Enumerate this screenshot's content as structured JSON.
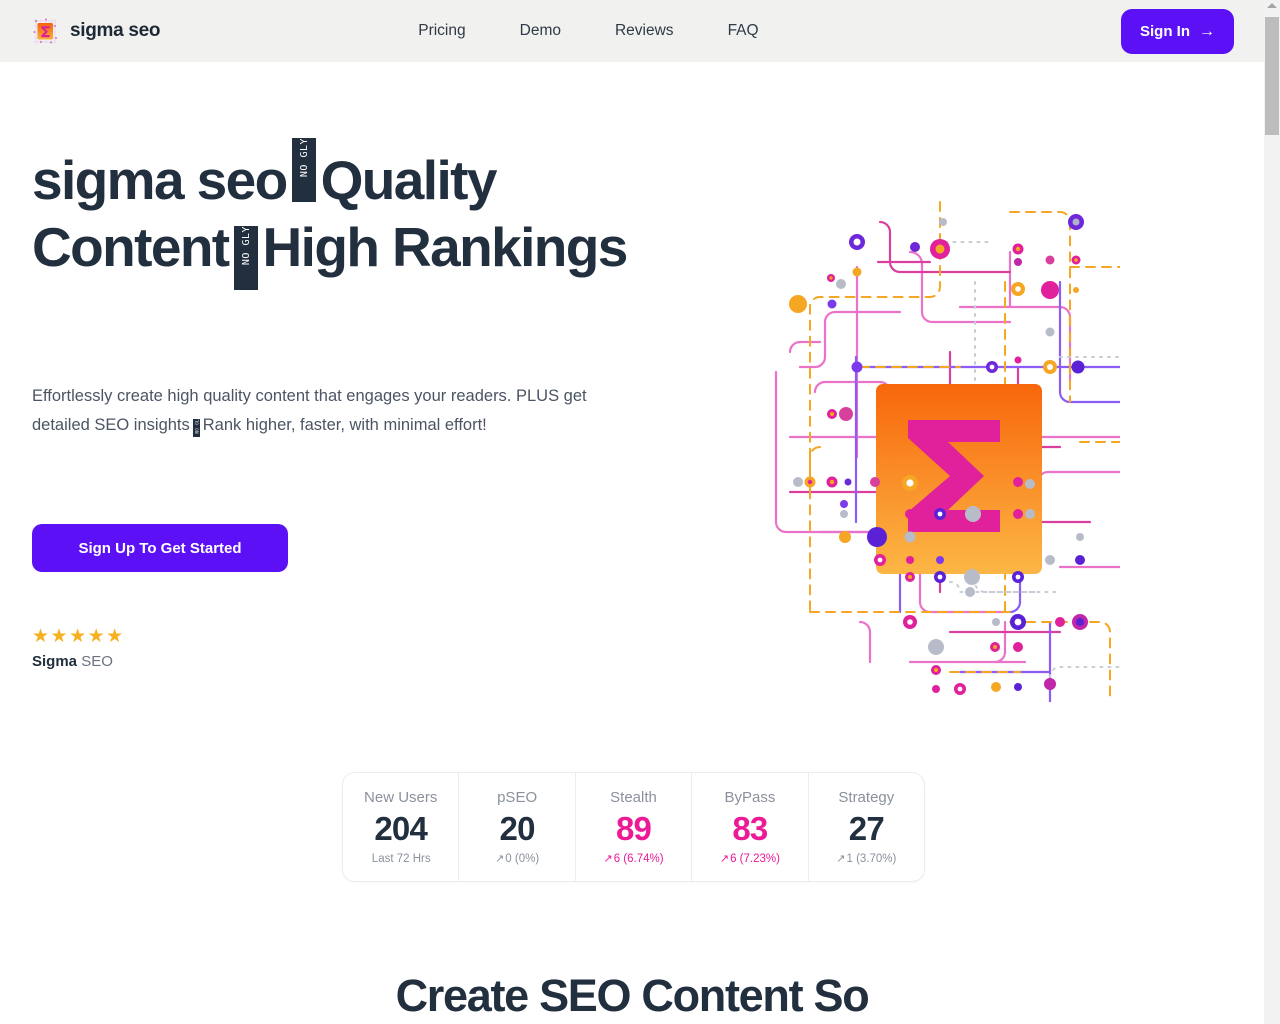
{
  "header": {
    "brand_name": "sigma seo",
    "brand_icon": "sigma-logo-icon",
    "nav": [
      {
        "label": "Pricing"
      },
      {
        "label": "Demo"
      },
      {
        "label": "Reviews"
      },
      {
        "label": "FAQ"
      }
    ],
    "signin_label": "Sign In",
    "signin_arrow": "→",
    "background": "#f1f1f0"
  },
  "hero": {
    "title_part1": "sigma seo",
    "title_glyph1": "NO GLYPH",
    "title_part2": "Quality Content",
    "title_glyph2": "NO GLYPH",
    "title_part3": "High Rankings",
    "subtitle_part1": "Effortlessly create high quality content that engages your readers. PLUS get detailed SEO insights",
    "subtitle_glyph": "NO GLYPH",
    "subtitle_part2": "Rank higher, faster, with minimal effort!",
    "cta_label": "Sign Up To Get Started",
    "stars": "★★★★★",
    "rating_brand": "Sigma",
    "rating_suffix": "SEO",
    "art_icon": "sigma-network-graphic"
  },
  "stats": [
    {
      "label": "New Users",
      "value": "204",
      "delta": "Last 72 Hrs",
      "accent": false,
      "arrow": ""
    },
    {
      "label": "pSEO",
      "value": "20",
      "delta": "0 (0%)",
      "accent": false,
      "arrow": "↗"
    },
    {
      "label": "Stealth",
      "value": "89",
      "delta": "6 (6.74%)",
      "accent": true,
      "arrow": "↗"
    },
    {
      "label": "ByPass",
      "value": "83",
      "delta": "6 (7.23%)",
      "accent": true,
      "arrow": "↗"
    },
    {
      "label": "Strategy",
      "value": "27",
      "delta": "1 (3.70%)",
      "accent": false,
      "arrow": "↗"
    }
  ],
  "section": {
    "heading": "Create SEO Content So"
  },
  "colors": {
    "purple": "#5b10f5",
    "pink": "#ec1a97",
    "gold": "#f5b120",
    "navy": "#222f3e",
    "orange": "#f97316"
  }
}
